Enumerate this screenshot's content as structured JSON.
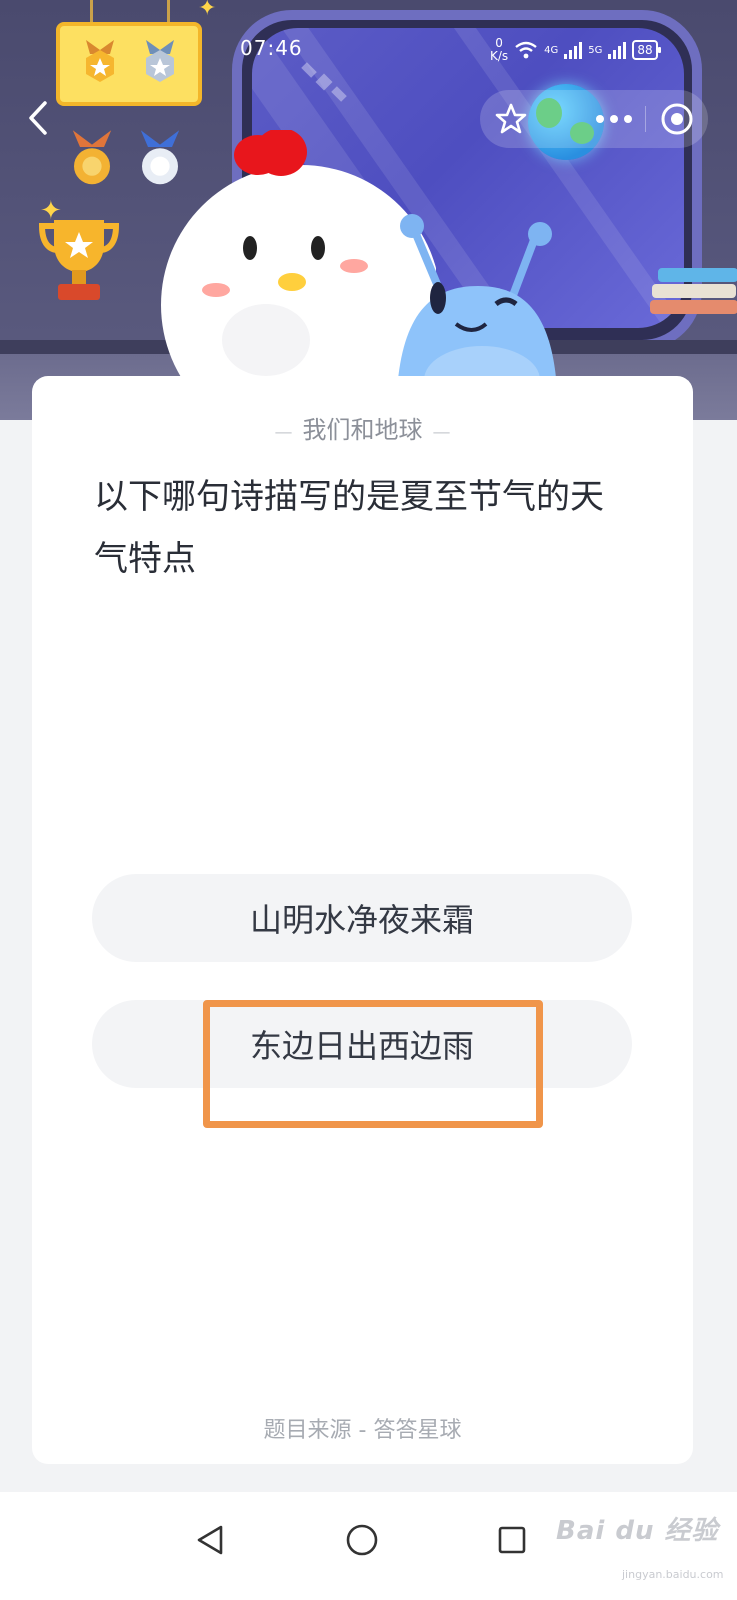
{
  "status_bar": {
    "time": "07:46",
    "net_speed_value": "0",
    "net_speed_unit": "K/s",
    "signal_1_label": "4G",
    "signal_2_label": "5G",
    "battery": "88"
  },
  "header": {
    "back_icon": "chevron-left-icon",
    "capsule_buttons": [
      "star-icon",
      "more-dots-icon",
      "target-icon"
    ]
  },
  "card": {
    "category": "我们和地球",
    "question": "以下哪句诗描写的是夏至节气的天气特点",
    "options": [
      {
        "label": "山明水净夜来霜"
      },
      {
        "label": "东边日出西边雨",
        "highlighted": true
      }
    ],
    "source": "题目来源 - 答答星球"
  },
  "navbar": {
    "buttons": [
      "back-triangle-icon",
      "home-circle-icon",
      "recents-square-icon"
    ]
  },
  "watermark": {
    "text": "Bai du 经验",
    "sub": "jingyan.baidu.com"
  },
  "colors": {
    "highlight": "#f0954a",
    "option_bg": "#f3f4f6",
    "header_bg": "#4a4a6e"
  }
}
